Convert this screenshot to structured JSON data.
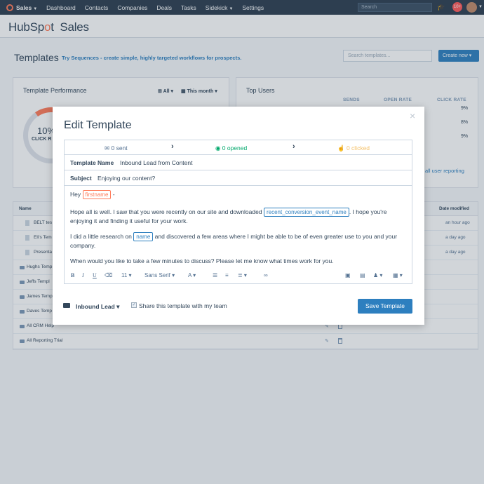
{
  "topnav": {
    "items": [
      "Sales",
      "Dashboard",
      "Contacts",
      "Companies",
      "Deals",
      "Tasks",
      "Sidekick",
      "Settings"
    ],
    "search_placeholder": "Search",
    "notification_count": "10+"
  },
  "brand": {
    "hub": "HubSp",
    "sprocket": "o",
    "t": "t",
    "product": "Sales"
  },
  "page": {
    "title": "Templates",
    "tip": "Try Sequences - create simple, highly targeted workflows for prospects.",
    "search_placeholder": "Search templates...",
    "create_button": "Create new"
  },
  "performance": {
    "title": "Template Performance",
    "filter_owner": "All",
    "filter_period": "This month",
    "gauge_value": "10%",
    "gauge_label": "CLICK R"
  },
  "top_users": {
    "title": "Top Users",
    "columns": [
      "SENDS",
      "OPEN RATE",
      "CLICK RATE"
    ],
    "click_rates": [
      "9%",
      "8%",
      "9%"
    ],
    "report_link": "all user reporting"
  },
  "table": {
    "col_name": "Name",
    "col_modified": "Date modified",
    "rows": [
      {
        "name": "BELT tes",
        "modified": "an hour ago"
      },
      {
        "name": "Eli's Tem",
        "modified": "a day ago"
      },
      {
        "name": "Presenta",
        "modified": "a day ago"
      },
      {
        "name": "Hughs Temp",
        "modified": ""
      },
      {
        "name": "Jeffs Templ",
        "modified": ""
      },
      {
        "name": "James Temp",
        "modified": ""
      },
      {
        "name": "Daves Temp",
        "modified": ""
      },
      {
        "name": "All CRM Help",
        "modified": ""
      },
      {
        "name": "All Reporting Trial",
        "modified": ""
      }
    ]
  },
  "modal": {
    "title": "Edit Template",
    "close": "×",
    "stats": {
      "sent": "0 sent",
      "opened": "0 opened",
      "clicked": "0 clicked"
    },
    "template_name_label": "Template Name",
    "template_name_value": "Inbound Lead from Content",
    "subject_label": "Subject",
    "subject_value": "Enjoying our content?",
    "body": {
      "greeting": "Hey",
      "token_firstname": "firstname",
      "greeting_end": "-",
      "p1_start": "Hope all is well. I saw that you were recently on our site and downloaded",
      "token_conversion": "recent_conversion_event_name",
      "p1_end": ". I hope you're enjoying it and finding it useful for your work.",
      "p2_start": "I did a little research on",
      "token_name": "name",
      "p2_end": "and discovered a few areas where I might be able to be of even greater use to you and your company.",
      "p3": "When would you like to take a few minutes to discuss? Please let me know what times work for you."
    },
    "toolbar": {
      "bold": "B",
      "italic": "I",
      "underline": "U",
      "font_size": "11",
      "font_family": "Sans Serif",
      "font_color": "A"
    },
    "folder": "Inbound Lead",
    "share_label": "Share this template with my team",
    "save_button": "Save Template"
  }
}
